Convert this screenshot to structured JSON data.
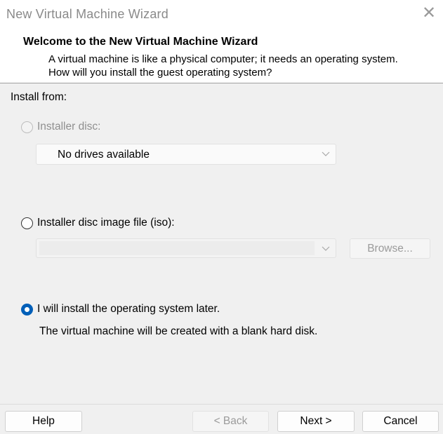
{
  "window": {
    "title": "New Virtual Machine Wizard",
    "close_icon": "close-icon"
  },
  "header": {
    "title": "Welcome to the New Virtual Machine Wizard",
    "subtitle": "A virtual machine is like a physical computer; it needs an operating system. How will you install the guest operating system?"
  },
  "install": {
    "section_label": "Install from:",
    "options": [
      {
        "label": "Installer disc:",
        "enabled": false,
        "selected": false
      },
      {
        "label": "Installer disc image file (iso):",
        "enabled": true,
        "selected": false
      },
      {
        "label": "I will install the operating system later.",
        "enabled": true,
        "selected": true
      }
    ],
    "disc_dropdown_value": "No drives available",
    "iso_path_value": "",
    "browse_label": "Browse...",
    "later_description": "The virtual machine will be created with a blank hard disk."
  },
  "footer": {
    "help_label": "Help",
    "back_label": "< Back",
    "next_label": "Next >",
    "cancel_label": "Cancel"
  },
  "colors": {
    "accent": "#005fb8",
    "disabled_text": "#8f8f8f"
  }
}
